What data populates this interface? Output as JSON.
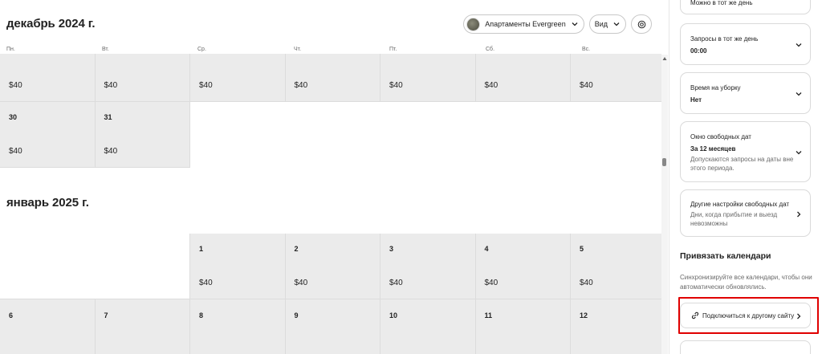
{
  "header": {
    "month_dec": "декабрь 2024 г.",
    "month_jan": "январь 2025 г.",
    "listing_name": "Апартаменты Evergreen",
    "view_label": "Вид"
  },
  "weekdays": [
    "Пн.",
    "Вт.",
    "Ср.",
    "Чт.",
    "Пт.",
    "Сб.",
    "Вс."
  ],
  "december": {
    "row1_prices": [
      "$40",
      "$40",
      "$40",
      "$40",
      "$40",
      "$40",
      "$40"
    ],
    "row2": [
      {
        "day": "30",
        "price": "$40"
      },
      {
        "day": "31",
        "price": "$40"
      }
    ]
  },
  "january": {
    "row1": [
      {
        "day": "1",
        "price": "$40"
      },
      {
        "day": "2",
        "price": "$40"
      },
      {
        "day": "3",
        "price": "$40"
      },
      {
        "day": "4",
        "price": "$40"
      },
      {
        "day": "5",
        "price": "$40"
      }
    ],
    "row2_days": [
      "6",
      "7",
      "8",
      "9",
      "10",
      "11",
      "12"
    ]
  },
  "panel": {
    "top_cut_text": "Можно в тот же день",
    "same_day": {
      "title": "Запросы в тот же день",
      "value": "00:00"
    },
    "cleaning": {
      "title": "Время на уборку",
      "value": "Нет"
    },
    "window": {
      "title": "Окно свободных дат",
      "value": "За 12 месяцев",
      "desc": "Допускаются запросы на даты вне этого периода."
    },
    "other": {
      "title": "Другие настройки свободных дат",
      "desc": "Дни, когда прибытие и выезд невозможны"
    },
    "sync_title": "Привязать календари",
    "sync_desc": "Синхронизируйте все календари, чтобы они автоматически обновлялись.",
    "connect_label": "Подключиться к другому сайту"
  },
  "colors": {
    "highlight": "#e00000",
    "gray_cell": "#ebebeb"
  }
}
